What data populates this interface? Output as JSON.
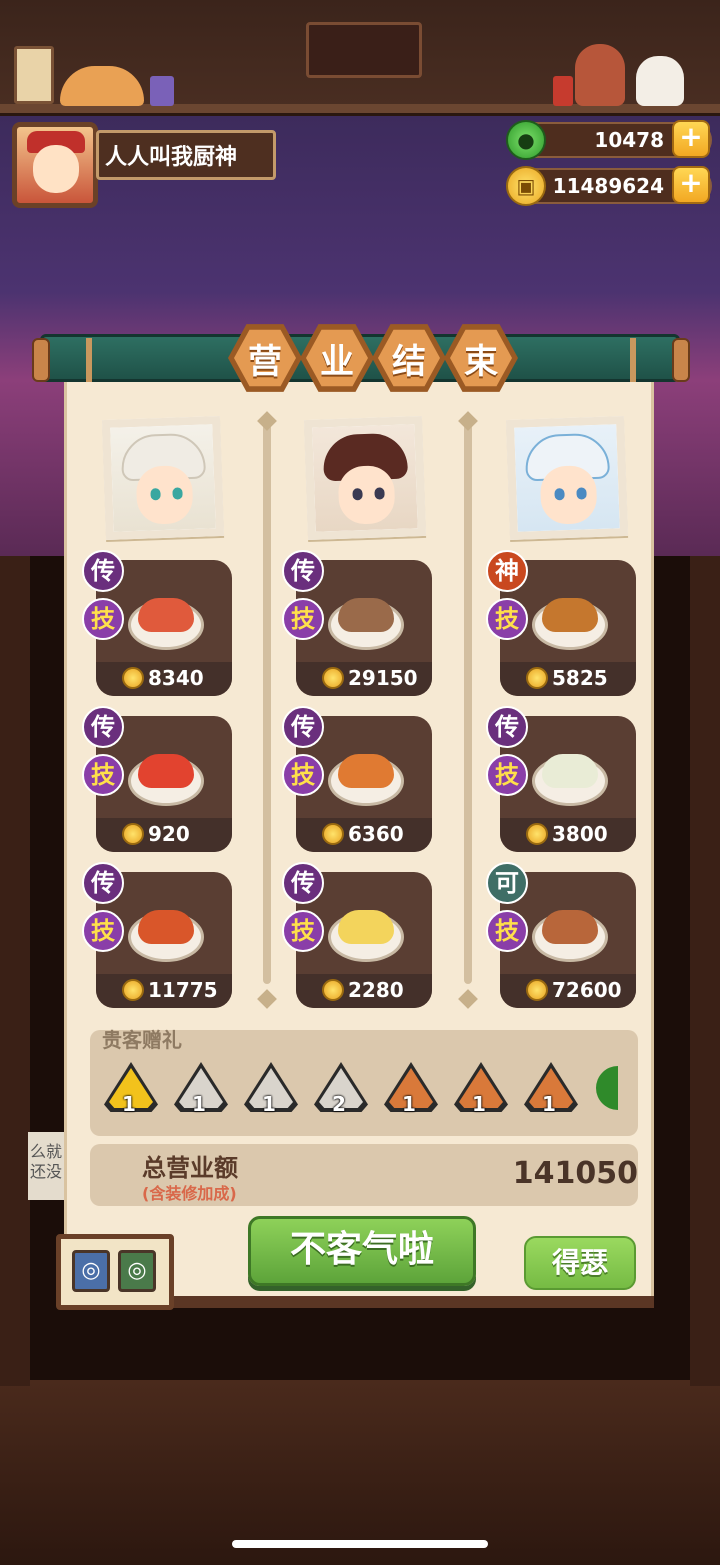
{
  "player": {
    "name": "人人叫我厨神"
  },
  "resources": {
    "jade": "10478",
    "coins": "11489624",
    "plus": "+"
  },
  "title_chars": [
    "营",
    "业",
    "结",
    "束"
  ],
  "chefs": [
    {
      "dishes": [
        {
          "rank": "传",
          "skill": "技",
          "price": "8340",
          "food_color": "#e05a3c"
        },
        {
          "rank": "传",
          "skill": "技",
          "price": "920",
          "food_color": "#e2432f"
        },
        {
          "rank": "传",
          "skill": "技",
          "price": "11775",
          "food_color": "#d9562a"
        }
      ]
    },
    {
      "dishes": [
        {
          "rank": "传",
          "skill": "技",
          "price": "29150",
          "food_color": "#9a6a4a"
        },
        {
          "rank": "传",
          "skill": "技",
          "price": "6360",
          "food_color": "#e07a32"
        },
        {
          "rank": "传",
          "skill": "技",
          "price": "2280",
          "food_color": "#f3d45c"
        }
      ]
    },
    {
      "dishes": [
        {
          "rank": "神",
          "skill": "技",
          "price": "5825",
          "food_color": "#c5772e"
        },
        {
          "rank": "传",
          "skill": "技",
          "price": "3800",
          "food_color": "#e9ecd6"
        },
        {
          "rank": "可",
          "skill": "技",
          "price": "72600",
          "food_color": "#b8663a"
        }
      ]
    }
  ],
  "gifts": {
    "label": "贵客赠礼",
    "items": [
      {
        "count": "1",
        "color": "#f2c21c",
        "icon": "gold-token-icon"
      },
      {
        "count": "1",
        "color": "#d9d4cc",
        "icon": "silver-token-icon"
      },
      {
        "count": "1",
        "color": "#d9d4cc",
        "icon": "silver-token-icon"
      },
      {
        "count": "2",
        "color": "#d9d4cc",
        "icon": "silver-token-icon"
      },
      {
        "count": "1",
        "color": "#d9793a",
        "icon": "bronze-token-icon"
      },
      {
        "count": "1",
        "color": "#d9793a",
        "icon": "bronze-token-icon"
      },
      {
        "count": "1",
        "color": "#d9793a",
        "icon": "bronze-token-icon"
      }
    ]
  },
  "total": {
    "label": "总营业额",
    "sub": "(含装修加成)",
    "value": "141050"
  },
  "buttons": {
    "confirm": "不客气啦",
    "side": "得瑟"
  },
  "side_note": "么就还没"
}
